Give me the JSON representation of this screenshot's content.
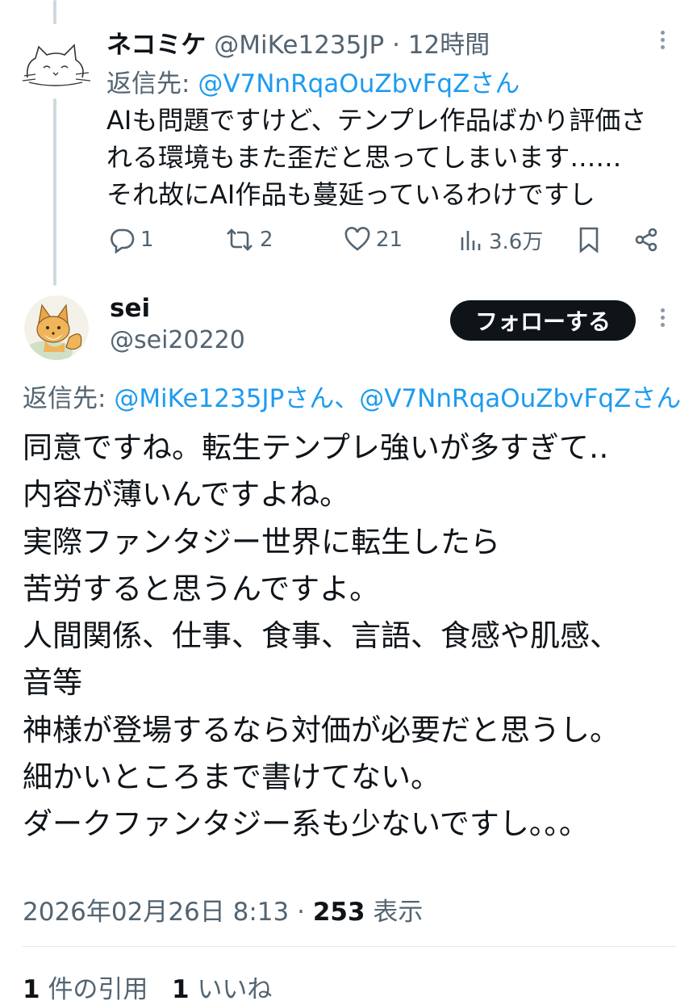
{
  "post1": {
    "display_name": "ネコミケ",
    "handle": "@MiKe1235JP",
    "separator": "·",
    "time": "12時間",
    "reply_prefix": "返信先:",
    "reply_mention": "@V7NnRqaOuZbvFqZさん",
    "body_lines": [
      "AIも問題ですけど、テンプレ作品ばかり評価さ",
      "れる環境もまた歪だと思ってしまいます……",
      "それ故にAI作品も蔓延っているわけですし"
    ],
    "actions": {
      "reply_count": "1",
      "repost_count": "2",
      "like_count": "21",
      "views_count": "3.6万"
    },
    "avatar_icon": "cat-line-drawing-avatar"
  },
  "post2": {
    "display_name": "sei",
    "handle": "@sei20220",
    "follow_label": "フォローする",
    "reply_prefix": "返信先:",
    "reply_mentions": "@MiKe1235JPさん、@V7NnRqaOuZbvFqZさん",
    "body_lines": [
      "同意ですね。転生テンプレ強いが多すぎて‥",
      "内容が薄いんですよね。",
      "実際ファンタジー世界に転生したら",
      "苦労すると思うんですよ。",
      "人間関係、仕事、食事、言語、食感や肌感、",
      "音等",
      "神様が登場するなら対価が必要だと思うし。",
      "細かいところまで書けてない。",
      "ダークファンタジー系も少ないですし。。。"
    ],
    "timestamp": "2026年02月26日 8:13",
    "separator": "·",
    "views_num": "253",
    "views_label": "表示",
    "quote_count": "1",
    "quote_label": "件の引用",
    "like_count": "1",
    "like_label": "いいね",
    "avatar_icon": "fox-illustration-avatar"
  },
  "colors": {
    "link": "#1d9bf0",
    "secondary_text": "#536471",
    "primary_text": "#0f1419",
    "thread_line": "#cfd9de"
  }
}
